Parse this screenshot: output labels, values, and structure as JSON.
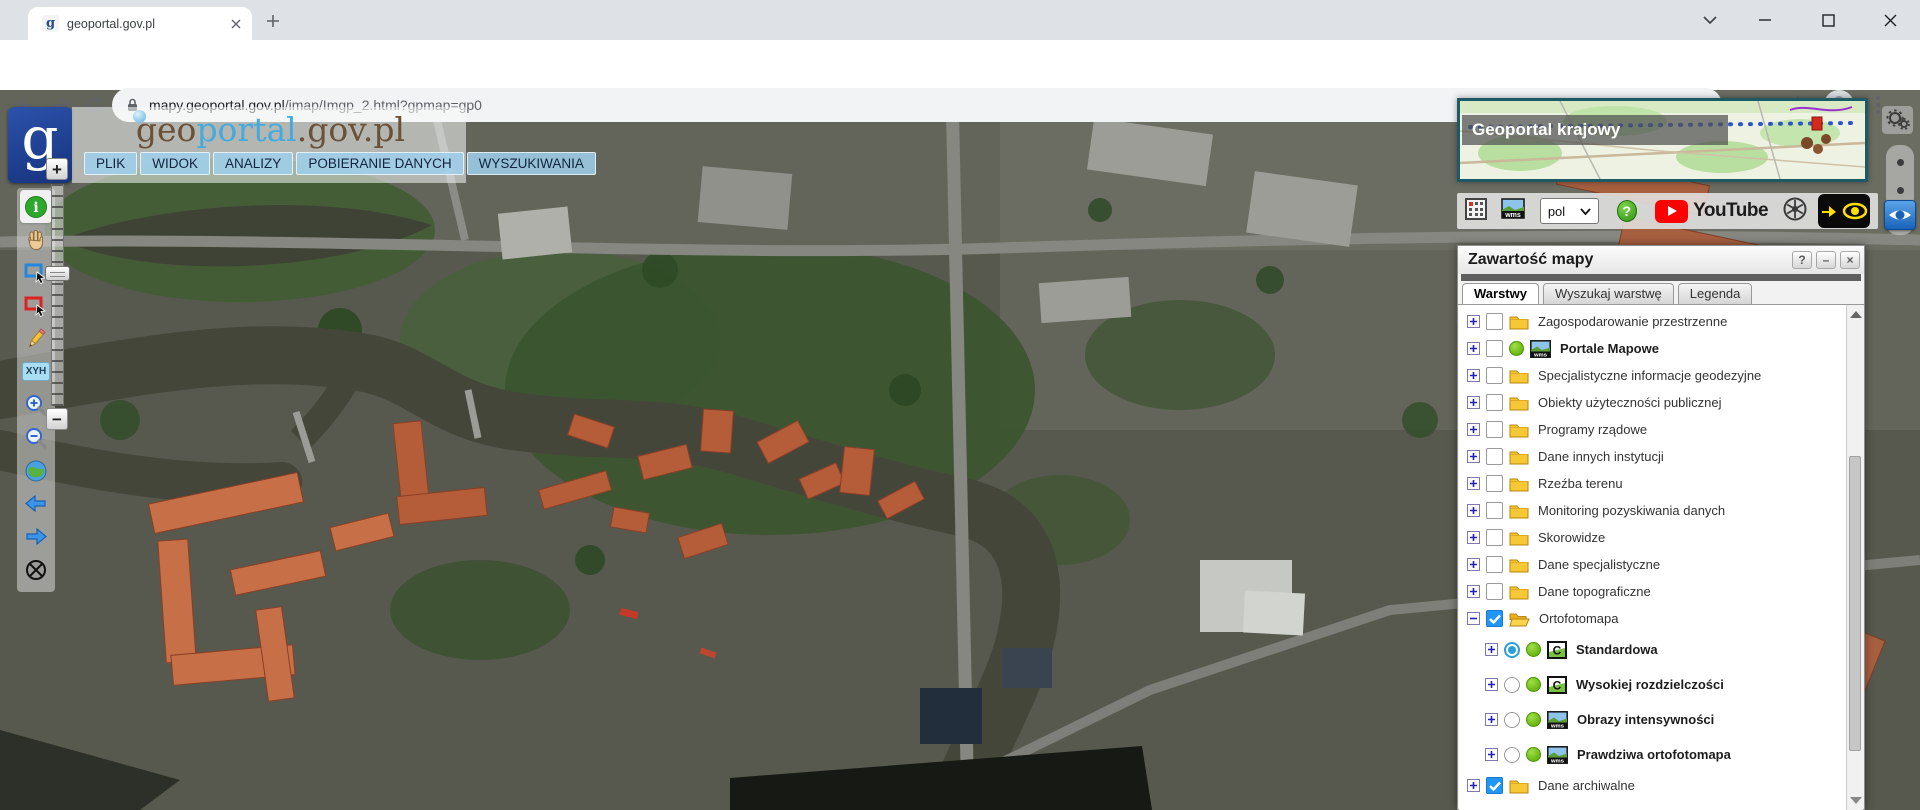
{
  "browser": {
    "tab_title": "geoportal.gov.pl",
    "url_domain": "mapy.geoportal.gov.pl",
    "url_path": "/imap/Imgp_2.html?gpmap=gp0"
  },
  "header": {
    "wordmark_geo": "geo",
    "wordmark_portal": "portal",
    "wordmark_suffix": ".gov.pl",
    "logo_letter": "g",
    "menu": [
      {
        "label": "PLIK"
      },
      {
        "label": "WIDOK"
      },
      {
        "label": "ANALIZY"
      },
      {
        "label": "POBIERANIE DANYCH"
      },
      {
        "label": "WYSZUKIWANIA"
      }
    ]
  },
  "left_toolbar": {
    "xyh_label": "XYH",
    "tools": [
      "identify",
      "pan",
      "zoom-by-rectangle",
      "clear-selection",
      "measure-draw",
      "coordinates-xyh",
      "zoom-in",
      "zoom-out",
      "full-extent",
      "previous-view",
      "next-view",
      "center-map"
    ]
  },
  "overview_panel": {
    "title": "Geoportal krajowy"
  },
  "top_toolbar": {
    "language_selected": "pol",
    "help_label": "?",
    "youtube_label": "YouTube"
  },
  "layers_panel": {
    "title": "Zawartość mapy",
    "help_label": "?",
    "minimize_label": "–",
    "close_label": "×",
    "wms_text": "wms",
    "cache_text": "C",
    "tabs": [
      {
        "label": "Warstwy",
        "active": true
      },
      {
        "label": "Wyszukaj warstwę",
        "active": false
      },
      {
        "label": "Legenda",
        "active": false
      }
    ],
    "tree": [
      {
        "expander": "plus",
        "control": "checkbox",
        "checked": false,
        "dot": false,
        "icon": "folder",
        "label": "Zagospodarowanie przestrzenne",
        "bold": false,
        "indent": 0
      },
      {
        "expander": "plus",
        "control": "checkbox",
        "checked": false,
        "dot": true,
        "icon": "wms",
        "label": "Portale Mapowe",
        "bold": true,
        "indent": 0
      },
      {
        "expander": "plus",
        "control": "checkbox",
        "checked": false,
        "dot": false,
        "icon": "folder",
        "label": "Specjalistyczne informacje geodezyjne",
        "bold": false,
        "indent": 0
      },
      {
        "expander": "plus",
        "control": "checkbox",
        "checked": false,
        "dot": false,
        "icon": "folder",
        "label": "Obiekty użyteczności publicznej",
        "bold": false,
        "indent": 0
      },
      {
        "expander": "plus",
        "control": "checkbox",
        "checked": false,
        "dot": false,
        "icon": "folder",
        "label": "Programy rządowe",
        "bold": false,
        "indent": 0
      },
      {
        "expander": "plus",
        "control": "checkbox",
        "checked": false,
        "dot": false,
        "icon": "folder",
        "label": "Dane innych instytucji",
        "bold": false,
        "indent": 0
      },
      {
        "expander": "plus",
        "control": "checkbox",
        "checked": false,
        "dot": false,
        "icon": "folder",
        "label": "Rzeźba terenu",
        "bold": false,
        "indent": 0
      },
      {
        "expander": "plus",
        "control": "checkbox",
        "checked": false,
        "dot": false,
        "icon": "folder",
        "label": "Monitoring pozyskiwania danych",
        "bold": false,
        "indent": 0
      },
      {
        "expander": "plus",
        "control": "checkbox",
        "checked": false,
        "dot": false,
        "icon": "folder",
        "label": "Skorowidze",
        "bold": false,
        "indent": 0
      },
      {
        "expander": "plus",
        "control": "checkbox",
        "checked": false,
        "dot": false,
        "icon": "folder",
        "label": "Dane specjalistyczne",
        "bold": false,
        "indent": 0
      },
      {
        "expander": "plus",
        "control": "checkbox",
        "checked": false,
        "dot": false,
        "icon": "folder",
        "label": "Dane topograficzne",
        "bold": false,
        "indent": 0
      },
      {
        "expander": "minus",
        "control": "checkbox",
        "checked": true,
        "dot": false,
        "icon": "folder-open",
        "label": "Ortofotomapa",
        "bold": false,
        "indent": 0
      },
      {
        "expander": "plus",
        "control": "radio",
        "checked": true,
        "dot": true,
        "icon": "cache",
        "label": "Standardowa",
        "bold": true,
        "indent": 1
      },
      {
        "expander": "plus",
        "control": "radio",
        "checked": false,
        "dot": true,
        "icon": "cache",
        "label": "Wysokiej rozdzielczości",
        "bold": true,
        "indent": 1
      },
      {
        "expander": "plus",
        "control": "radio",
        "checked": false,
        "dot": true,
        "icon": "wms",
        "label": "Obrazy intensywności",
        "bold": true,
        "indent": 1
      },
      {
        "expander": "plus",
        "control": "radio",
        "checked": false,
        "dot": true,
        "icon": "wms",
        "label": "Prawdziwa ortofotomapa",
        "bold": true,
        "indent": 1
      },
      {
        "expander": "plus",
        "control": "checkbox",
        "checked": true,
        "dot": false,
        "icon": "folder",
        "label": "Dane archiwalne",
        "bold": false,
        "indent": 0
      }
    ]
  },
  "colors": {
    "accent_blue": "#2196f3",
    "panel_border_teal": "#1c5a66",
    "wordmark_brown": "#6b5138",
    "wordmark_blue": "#45aadd",
    "youtube_red": "#ff0000",
    "highlight_yellow": "#ffe000"
  }
}
